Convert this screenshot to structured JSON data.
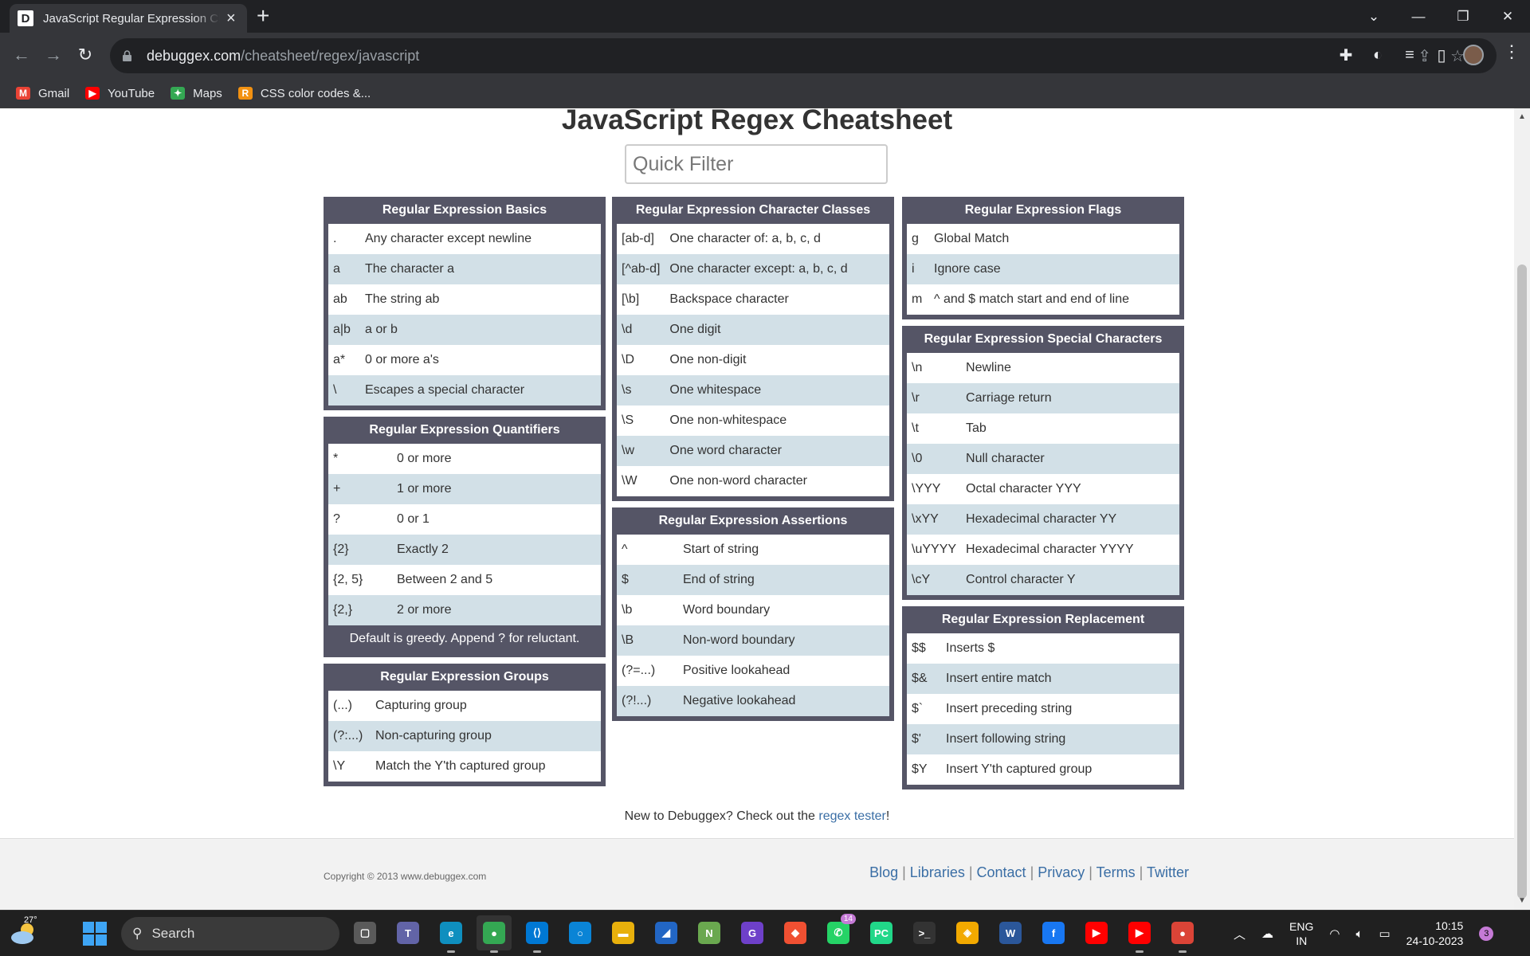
{
  "browser": {
    "tab_title": "JavaScript Regular Expression Cheatsheet",
    "favicon_letter": "D",
    "url_host": "debuggex.com",
    "url_path": "/cheatsheet/regex/javascript",
    "bookmarks": [
      {
        "label": "Gmail",
        "icon": "gmail-icon",
        "color": "#ea4335",
        "glyph": "M"
      },
      {
        "label": "YouTube",
        "icon": "youtube-icon",
        "color": "#ff0000",
        "glyph": "▶"
      },
      {
        "label": "Maps",
        "icon": "maps-icon",
        "color": "#34a853",
        "glyph": "✦"
      },
      {
        "label": "CSS color codes &...",
        "icon": "r-logo-icon",
        "color": "#f29111",
        "glyph": "R"
      }
    ]
  },
  "page": {
    "title": "JavaScript Regex Cheatsheet",
    "filter_placeholder": "Quick Filter",
    "sections": {
      "basics": {
        "title": "Regular Expression Basics",
        "rows": [
          [
            ".",
            "Any character except newline"
          ],
          [
            "a",
            "The character a"
          ],
          [
            "ab",
            "The string ab"
          ],
          [
            "a|b",
            "a or b"
          ],
          [
            "a*",
            "0 or more a's"
          ],
          [
            "\\",
            "Escapes a special character"
          ]
        ]
      },
      "quantifiers": {
        "title": "Regular Expression Quantifiers",
        "rows": [
          [
            "*",
            "0 or more"
          ],
          [
            "+",
            "1 or more"
          ],
          [
            "?",
            "0 or 1"
          ],
          [
            "{2}",
            "Exactly 2"
          ],
          [
            "{2, 5}",
            "Between 2 and 5"
          ],
          [
            "{2,}",
            "2 or more"
          ]
        ],
        "note": "Default is greedy. Append ? for reluctant."
      },
      "groups": {
        "title": "Regular Expression Groups",
        "rows": [
          [
            "(...)",
            "Capturing group"
          ],
          [
            "(?:...)",
            "Non-capturing group"
          ],
          [
            "\\Y",
            "Match the Y'th captured group"
          ]
        ]
      },
      "classes": {
        "title": "Regular Expression Character Classes",
        "rows": [
          [
            "[ab-d]",
            "One character of: a, b, c, d"
          ],
          [
            "[^ab-d]",
            "One character except: a, b, c, d"
          ],
          [
            "[\\b]",
            "Backspace character"
          ],
          [
            "\\d",
            "One digit"
          ],
          [
            "\\D",
            "One non-digit"
          ],
          [
            "\\s",
            "One whitespace"
          ],
          [
            "\\S",
            "One non-whitespace"
          ],
          [
            "\\w",
            "One word character"
          ],
          [
            "\\W",
            "One non-word character"
          ]
        ]
      },
      "assertions": {
        "title": "Regular Expression Assertions",
        "rows": [
          [
            "^",
            "Start of string"
          ],
          [
            "$",
            "End of string"
          ],
          [
            "\\b",
            "Word boundary"
          ],
          [
            "\\B",
            "Non-word boundary"
          ],
          [
            "(?=...)",
            "Positive lookahead"
          ],
          [
            "(?!...)",
            "Negative lookahead"
          ]
        ]
      },
      "flags": {
        "title": "Regular Expression Flags",
        "rows": [
          [
            "g",
            "Global Match"
          ],
          [
            "i",
            "Ignore case"
          ],
          [
            "m",
            "^ and $ match start and end of line"
          ]
        ]
      },
      "special": {
        "title": "Regular Expression Special Characters",
        "rows": [
          [
            "\\n",
            "Newline"
          ],
          [
            "\\r",
            "Carriage return"
          ],
          [
            "\\t",
            "Tab"
          ],
          [
            "\\0",
            "Null character"
          ],
          [
            "\\YYY",
            "Octal character YYY"
          ],
          [
            "\\xYY",
            "Hexadecimal character YY"
          ],
          [
            "\\uYYYY",
            "Hexadecimal character YYYY"
          ],
          [
            "\\cY",
            "Control character Y"
          ]
        ]
      },
      "replacement": {
        "title": "Regular Expression Replacement",
        "rows": [
          [
            "$$",
            "Inserts $"
          ],
          [
            "$&",
            "Insert entire match"
          ],
          [
            "$`",
            "Insert preceding string"
          ],
          [
            "$'",
            "Insert following string"
          ],
          [
            "$Y",
            "Insert Y'th captured group"
          ]
        ]
      }
    },
    "cta_text": "New to Debuggex? Check out the ",
    "cta_link": "regex tester",
    "cta_end": "!",
    "copyright": "Copyright © 2013 www.debuggex.com",
    "footer_links": [
      "Blog",
      "Libraries",
      "Contact",
      "Privacy",
      "Terms",
      "Twitter"
    ]
  },
  "taskbar": {
    "temperature": "27°",
    "search_label": "Search",
    "whatsapp_badge": "14",
    "lang_line1": "ENG",
    "lang_line2": "IN",
    "time": "10:15",
    "date": "24-10-2023",
    "notification_count": "3",
    "apps": [
      {
        "name": "task-view-icon",
        "color": "#5a5a5a",
        "glyph": "▢"
      },
      {
        "name": "teams-icon",
        "color": "#6264a7",
        "glyph": "T"
      },
      {
        "name": "edge-icon",
        "color": "#0f8fbf",
        "glyph": "e"
      },
      {
        "name": "chrome-profile-icon",
        "color": "#34a853",
        "glyph": "●",
        "active": true
      },
      {
        "name": "vscode-icon",
        "color": "#0078d4",
        "glyph": "⟨⟩"
      },
      {
        "name": "cortana-icon",
        "color": "#0a84d6",
        "glyph": "○"
      },
      {
        "name": "file-explorer-icon",
        "color": "#e8b00c",
        "glyph": "▬"
      },
      {
        "name": "azure-data-studio-icon",
        "color": "#2266c4",
        "glyph": "◢"
      },
      {
        "name": "notepad-plus-icon",
        "color": "#6aa84f",
        "glyph": "N"
      },
      {
        "name": "github-desktop-icon",
        "color": "#6e40c9",
        "glyph": "G"
      },
      {
        "name": "git-icon",
        "color": "#f05032",
        "glyph": "◆"
      },
      {
        "name": "whatsapp-icon",
        "color": "#25d366",
        "glyph": "✆"
      },
      {
        "name": "pycharm-icon",
        "color": "#21d789",
        "glyph": "PC"
      },
      {
        "name": "terminal-icon",
        "color": "#333333",
        "glyph": ">_"
      },
      {
        "name": "jetbrains-toolbox-icon",
        "color": "#f2a900",
        "glyph": "◈"
      },
      {
        "name": "word-icon",
        "color": "#2b579a",
        "glyph": "W"
      },
      {
        "name": "facebook-icon",
        "color": "#1877f2",
        "glyph": "f"
      },
      {
        "name": "youtube-icon",
        "color": "#ff0000",
        "glyph": "▶"
      },
      {
        "name": "youtube-profile-icon",
        "color": "#ff0000",
        "glyph": "▶"
      },
      {
        "name": "chrome-icon",
        "color": "#db4437",
        "glyph": "●"
      }
    ]
  }
}
